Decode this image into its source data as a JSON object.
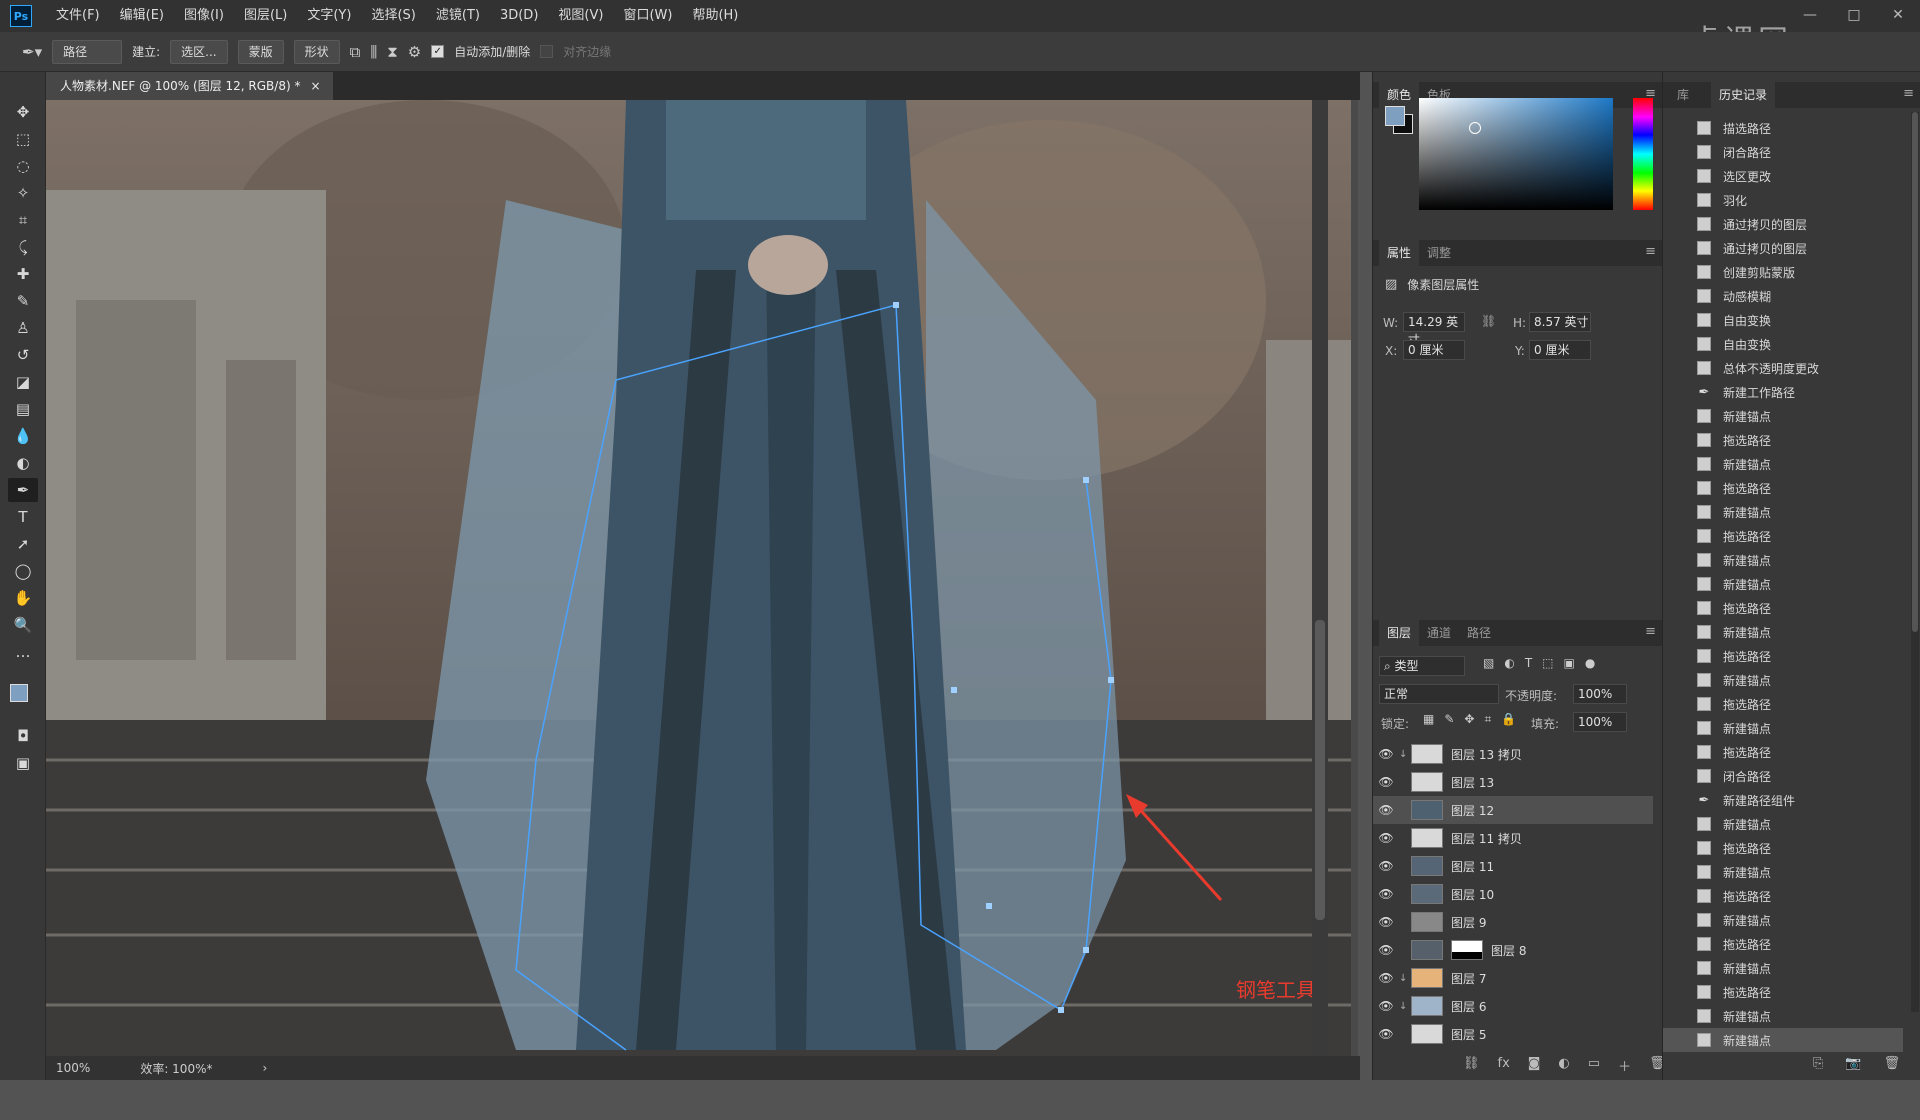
{
  "menubar": {
    "logo": "Ps",
    "items": [
      "文件(F)",
      "编辑(E)",
      "图像(I)",
      "图层(L)",
      "文字(Y)",
      "选择(S)",
      "滤镜(T)",
      "3D(D)",
      "视图(V)",
      "窗口(W)",
      "帮助(H)"
    ],
    "window_controls": [
      "—",
      "□",
      "✕"
    ]
  },
  "options": {
    "mode": "路径",
    "build_label": "建立:",
    "selection_btn": "选区...",
    "mask_btn": "蒙版",
    "shape_btn": "形状",
    "auto_add_delete": "自动添加/删除",
    "align_edges": "对齐边缘"
  },
  "document": {
    "tab_title": "人物素材.NEF @ 100% (图层 12, RGB/8) *",
    "close": "×"
  },
  "status": {
    "zoom": "100%",
    "efficiency": "效率: 100%*",
    "arrow": "›"
  },
  "annotation": {
    "label": "钢笔工具",
    "color": "#e83a2d"
  },
  "color_panel": {
    "tabs": [
      "颜色",
      "色板"
    ],
    "fg_color": "#7e9fbf",
    "bg_color": "#0e0e0e"
  },
  "properties": {
    "tabs": [
      "属性",
      "调整"
    ],
    "title": "像素图层属性",
    "w_label": "W:",
    "w_value": "14.29 英寸",
    "h_label": "H:",
    "h_value": "8.57 英寸",
    "x_label": "X:",
    "x_value": "0 厘米",
    "y_label": "Y:",
    "y_value": "0 厘米"
  },
  "layers_panel": {
    "tabs": [
      "图层",
      "通道",
      "路径"
    ],
    "filter": "类型",
    "blend": "正常",
    "opacity_label": "不透明度:",
    "opacity": "100%",
    "lock_label": "锁定:",
    "fill_label": "填充:",
    "fill": "100%",
    "layers": [
      {
        "name": "图层 13 拷贝"
      },
      {
        "name": "图层 13"
      },
      {
        "name": "图层 12"
      },
      {
        "name": "图层 11 拷贝"
      },
      {
        "name": "图层 11"
      },
      {
        "name": "图层 10"
      },
      {
        "name": "图层 9"
      },
      {
        "name": "图层 8"
      },
      {
        "name": "图层 7"
      },
      {
        "name": "图层 6"
      },
      {
        "name": "图层 5"
      }
    ]
  },
  "history_panel": {
    "tabs": [
      "库",
      "历史记录"
    ],
    "items": [
      "描选路径",
      "闭合路径",
      "选区更改",
      "羽化",
      "通过拷贝的图层",
      "通过拷贝的图层",
      "创建剪贴蒙版",
      "动感模糊",
      "自由变换",
      "自由变换",
      "总体不透明度更改",
      "新建工作路径",
      "新建锚点",
      "拖选路径",
      "新建锚点",
      "拖选路径",
      "新建锚点",
      "拖选路径",
      "新建锚点",
      "新建锚点",
      "拖选路径",
      "新建锚点",
      "拖选路径",
      "新建锚点",
      "拖选路径",
      "新建锚点",
      "拖选路径",
      "闭合路径",
      "新建路径组件",
      "新建锚点",
      "拖选路径",
      "新建锚点",
      "拖选路径",
      "新建锚点",
      "拖选路径",
      "新建锚点",
      "拖选路径",
      "新建锚点",
      "新建锚点"
    ]
  },
  "watermark": "虎课网"
}
